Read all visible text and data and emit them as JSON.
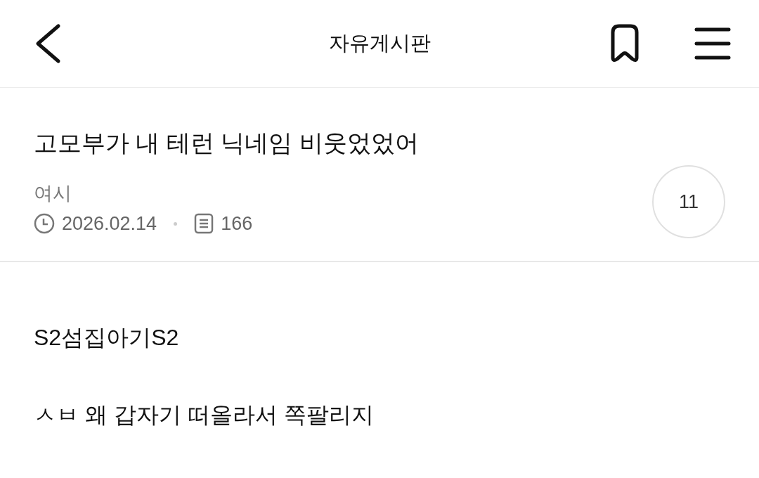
{
  "header": {
    "title": "자유게시판"
  },
  "post": {
    "title": "고모부가 내 테런 닉네임 비웃었었어",
    "author": "여시",
    "date": "2026.02.14",
    "views": "166",
    "comment_count": "11"
  },
  "body": [
    "S2섬집아기S2",
    "ㅅㅂ 왜 갑자기 떠올라서 쪽팔리지"
  ]
}
